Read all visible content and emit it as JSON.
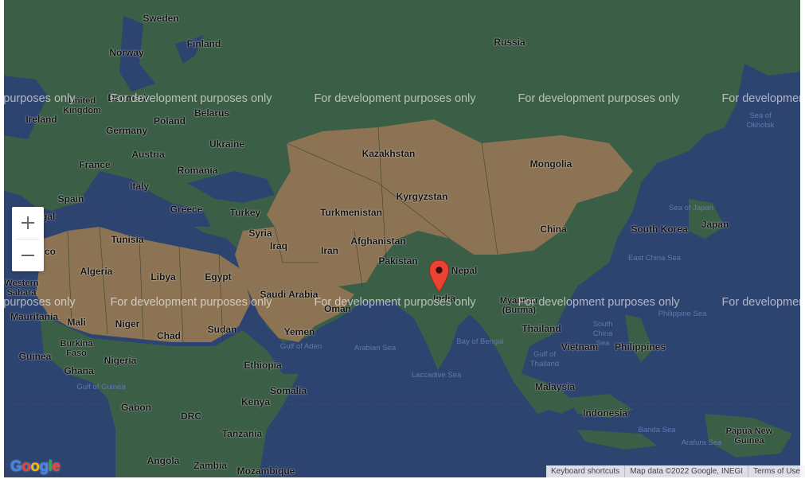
{
  "map": {
    "countries": [
      {
        "name": "Sweden",
        "kind": "land"
      },
      {
        "name": "Finland",
        "kind": "land"
      },
      {
        "name": "Norway",
        "kind": "land"
      },
      {
        "name": "Denmark",
        "kind": "land"
      },
      {
        "name": "United Kingdom",
        "kind": "land"
      },
      {
        "name": "Ireland",
        "kind": "land"
      },
      {
        "name": "Belarus",
        "kind": "land"
      },
      {
        "name": "Poland",
        "kind": "land"
      },
      {
        "name": "Germany",
        "kind": "land"
      },
      {
        "name": "Ukraine",
        "kind": "land"
      },
      {
        "name": "France",
        "kind": "land"
      },
      {
        "name": "Austria",
        "kind": "land"
      },
      {
        "name": "Romania",
        "kind": "land"
      },
      {
        "name": "Italy",
        "kind": "land"
      },
      {
        "name": "Spain",
        "kind": "land"
      },
      {
        "name": "Portugal",
        "kind": "land"
      },
      {
        "name": "Greece",
        "kind": "land"
      },
      {
        "name": "Turkey",
        "kind": "land"
      },
      {
        "name": "Tunisia",
        "kind": "land"
      },
      {
        "name": "Morocco",
        "kind": "land"
      },
      {
        "name": "Algeria",
        "kind": "land"
      },
      {
        "name": "Libya",
        "kind": "land"
      },
      {
        "name": "Egypt",
        "kind": "land"
      },
      {
        "name": "Western Sahara",
        "kind": "land"
      },
      {
        "name": "Mauritania",
        "kind": "land"
      },
      {
        "name": "Mali",
        "kind": "land"
      },
      {
        "name": "Niger",
        "kind": "land"
      },
      {
        "name": "Chad",
        "kind": "land"
      },
      {
        "name": "Sudan",
        "kind": "land"
      },
      {
        "name": "Burkina Faso",
        "kind": "land"
      },
      {
        "name": "Guinea",
        "kind": "land"
      },
      {
        "name": "Ghana",
        "kind": "land"
      },
      {
        "name": "Nigeria",
        "kind": "land"
      },
      {
        "name": "Ethiopia",
        "kind": "land"
      },
      {
        "name": "Somalia",
        "kind": "land"
      },
      {
        "name": "Kenya",
        "kind": "land"
      },
      {
        "name": "Gabon",
        "kind": "land"
      },
      {
        "name": "DRC",
        "kind": "land"
      },
      {
        "name": "Tanzania",
        "kind": "land"
      },
      {
        "name": "Angola",
        "kind": "land"
      },
      {
        "name": "Zambia",
        "kind": "land"
      },
      {
        "name": "Mozambique",
        "kind": "land"
      },
      {
        "name": "Syria",
        "kind": "land"
      },
      {
        "name": "Iraq",
        "kind": "land"
      },
      {
        "name": "Iran",
        "kind": "land"
      },
      {
        "name": "Saudi Arabia",
        "kind": "land"
      },
      {
        "name": "Yemen",
        "kind": "land"
      },
      {
        "name": "Oman",
        "kind": "land"
      },
      {
        "name": "Russia",
        "kind": "land"
      },
      {
        "name": "Kazakhstan",
        "kind": "land"
      },
      {
        "name": "Mongolia",
        "kind": "land"
      },
      {
        "name": "Kyrgyzstan",
        "kind": "land"
      },
      {
        "name": "Turkmenistan",
        "kind": "land"
      },
      {
        "name": "Afghanistan",
        "kind": "land"
      },
      {
        "name": "Pakistan",
        "kind": "land"
      },
      {
        "name": "Nepal",
        "kind": "land"
      },
      {
        "name": "India",
        "kind": "land"
      },
      {
        "name": "Myanmar (Burma)",
        "kind": "land"
      },
      {
        "name": "Thailand",
        "kind": "land"
      },
      {
        "name": "Vietnam",
        "kind": "land"
      },
      {
        "name": "China",
        "kind": "land"
      },
      {
        "name": "South Korea",
        "kind": "land"
      },
      {
        "name": "Japan",
        "kind": "land"
      },
      {
        "name": "Philippines",
        "kind": "land"
      },
      {
        "name": "Malaysia",
        "kind": "land"
      },
      {
        "name": "Indonesia",
        "kind": "land"
      },
      {
        "name": "Papua New Guinea",
        "kind": "land"
      }
    ],
    "seas": [
      "Sea of Okhotsk",
      "Sea of Japan",
      "East China Sea",
      "Philippine Sea",
      "South China Sea",
      "Gulf of Thailand",
      "Bay of Bengal",
      "Arabian Sea",
      "Laccadive Sea",
      "Gulf of Aden",
      "Gulf of Guinea",
      "Banda Sea",
      "Arafura Sea"
    ],
    "watermark": "For development purposes only",
    "marker": {
      "title": "India",
      "color": "#ea4335"
    },
    "colors": {
      "water": "#2d4370",
      "forest": "#3b5e47",
      "desert": "#8c7353"
    }
  },
  "controls": {
    "zoom_in_symbol": "+",
    "zoom_out_symbol": "−"
  },
  "branding": {
    "logo_letters": [
      "G",
      "o",
      "o",
      "g",
      "l",
      "e"
    ],
    "logo_colors": [
      "#4285f4",
      "#ea4335",
      "#fbbc05",
      "#4285f4",
      "#34a853",
      "#ea4335"
    ]
  },
  "footer": {
    "keyboard_shortcuts": "Keyboard shortcuts",
    "map_data": "Map data ©2022 Google, INEGI",
    "terms": "Terms of Use"
  }
}
